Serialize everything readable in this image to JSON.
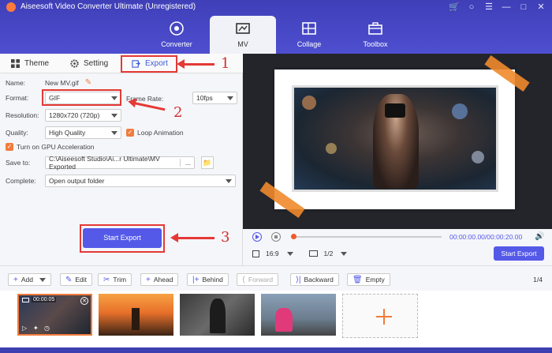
{
  "app": {
    "title": "Aiseesoft Video Converter Ultimate (Unregistered)"
  },
  "window_controls": [
    "cart-icon",
    "user-icon",
    "menu-icon",
    "minimize-icon",
    "maximize-icon",
    "close-icon"
  ],
  "tabs": [
    {
      "label": "Converter",
      "icon": "converter-icon"
    },
    {
      "label": "MV",
      "icon": "mv-icon",
      "active": true
    },
    {
      "label": "Collage",
      "icon": "collage-icon"
    },
    {
      "label": "Toolbox",
      "icon": "toolbox-icon"
    }
  ],
  "subtabs": {
    "theme": "Theme",
    "setting": "Setting",
    "export": "Export"
  },
  "form": {
    "name_label": "Name:",
    "name_value": "New MV.gif",
    "format_label": "Format:",
    "format_value": "GIF",
    "frame_rate_label": "Frame Rate:",
    "frame_rate_value": "10fps",
    "resolution_label": "Resolution:",
    "resolution_value": "1280x720 (720p)",
    "quality_label": "Quality:",
    "quality_value": "High Quality",
    "loop_label": "Loop Animation",
    "gpu_label": "Turn on GPU Acceleration",
    "save_label": "Save to:",
    "save_value": "C:\\Aiseesoft Studio\\Ai...r Ultimate\\MV Exported",
    "save_more": "...",
    "complete_label": "Complete:",
    "complete_value": "Open output folder",
    "start_export": "Start Export"
  },
  "annotations": {
    "n1": "1",
    "n2": "2",
    "n3": "3"
  },
  "player": {
    "time": "00:00:00.00/00:00:20.00",
    "aspect": "16:9",
    "page": "1/2",
    "start_export": "Start Export"
  },
  "toolbar": {
    "add": "Add",
    "edit": "Edit",
    "trim": "Trim",
    "ahead": "Ahead",
    "behind": "Behind",
    "forward": "Forward",
    "backward": "Backward",
    "empty": "Empty",
    "page_count": "1/4"
  },
  "thumbs": {
    "first_time": "00:00:05"
  },
  "colors": {
    "accent": "#5459e8",
    "header": "#4546c4",
    "highlight": "#e53935",
    "orange": "#f27b3d"
  }
}
